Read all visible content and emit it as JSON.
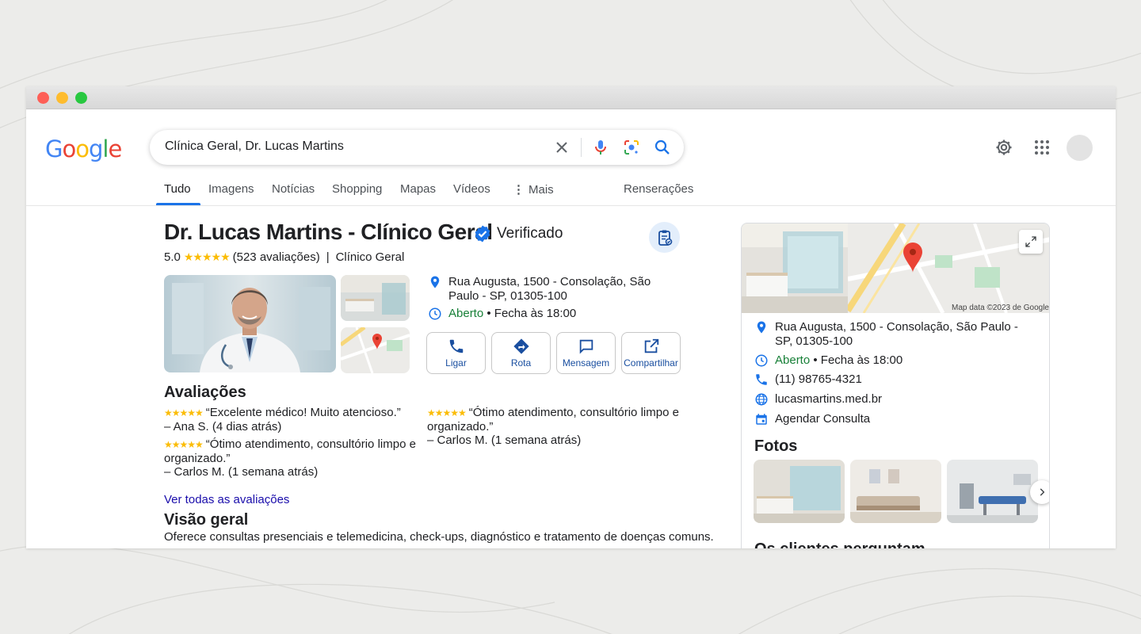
{
  "search": {
    "query": "Clínica Geral, Dr. Lucas Martins"
  },
  "tabs": [
    "Tudo",
    "Imagens",
    "Notícias",
    "Shopping",
    "Mapas",
    "Vídeos",
    "Mais",
    "Renserações"
  ],
  "business": {
    "title": "Dr. Lucas Martins - Clínico Geral",
    "verified_label": "Verificado",
    "rating": "5.0",
    "review_count": "(523 avaliações)",
    "separator": "|",
    "category": "Clínico Geral",
    "address": "Rua Augusta, 1500 - Consolação, São Paulo - SP, 01305-100",
    "status_open": "Aberto",
    "status_close": "• Fecha às 18:00",
    "phone": "(11) 98765-4321",
    "website": "lucasmartins.med.br",
    "booking": "Agendar Consulta"
  },
  "actions": [
    "Ligar",
    "Rota",
    "Mensagem",
    "Compartilhar"
  ],
  "reviews": {
    "title": "Avaliações",
    "items": [
      {
        "text": "“Excelente médico! Muito atencioso.”",
        "author": "– Ana S. (4 dias atrás)"
      },
      {
        "text": "“Ótimo atendimento, consultório limpo e organizado.”",
        "author": "– Carlos M. (1 semana atrás)"
      },
      {
        "text": "“Ótimo atendimento, consultório limpo e organizado.”",
        "author": "– Carlos M. (1 semana atrás)"
      }
    ],
    "see_all": "Ver todas as avaliações"
  },
  "overview": {
    "title": "Visão geral",
    "text": "Oferece consultas presenciais e telemedicina, check-ups, diagnóstico e tratamento de doenças comuns."
  },
  "side_panel": {
    "map_credit": "Map data ©2023 de Google",
    "photos_title": "Fotos",
    "more_title": "Os clientes perguntam"
  },
  "colors": {
    "accent": "#1a73e8",
    "star": "#fbbc04",
    "open": "#188038",
    "verified": "#1a73e8"
  }
}
